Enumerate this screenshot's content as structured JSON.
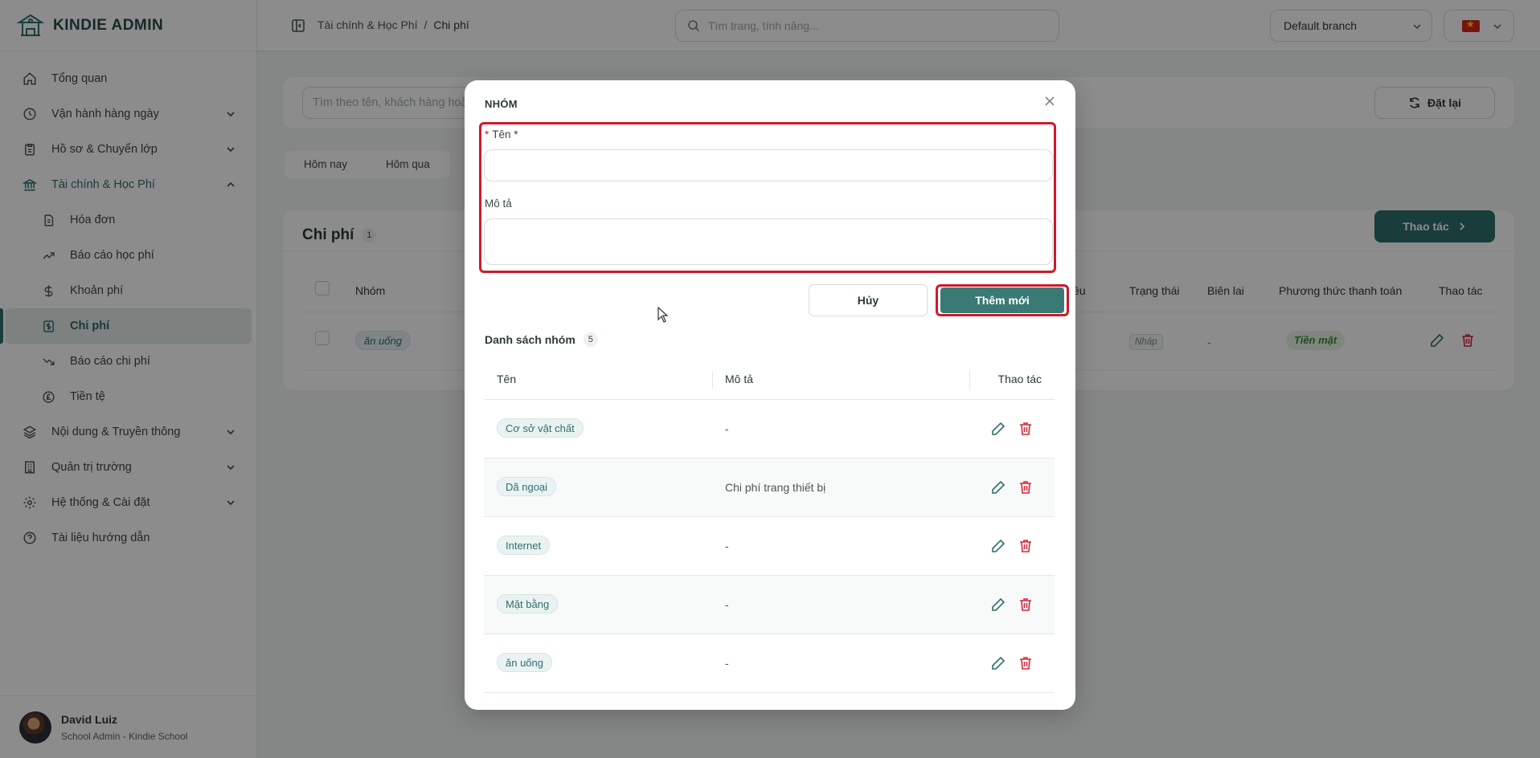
{
  "app": {
    "name": "KINDIE ADMIN"
  },
  "sidebar": {
    "items": [
      {
        "label": "Tổng quan",
        "icon": "home-icon"
      },
      {
        "label": "Vận hành hàng ngày",
        "icon": "clock-icon"
      },
      {
        "label": "Hồ sơ & Chuyển lớp",
        "icon": "clipboard-icon"
      },
      {
        "label": "Tài chính & Học Phí",
        "icon": "bank-icon"
      },
      {
        "label": "Nội dung & Truyền thông",
        "icon": "layers-icon"
      },
      {
        "label": "Quản trị trường",
        "icon": "building-icon"
      },
      {
        "label": "Hệ thống & Cài đặt",
        "icon": "gear-icon"
      },
      {
        "label": "Tài liệu hướng dẫn",
        "icon": "help-icon"
      }
    ],
    "finance_sub": [
      {
        "label": "Hóa đơn",
        "icon": "invoice-icon"
      },
      {
        "label": "Báo cáo học phí",
        "icon": "trend-up-icon"
      },
      {
        "label": "Khoản phí",
        "icon": "dollar-icon"
      },
      {
        "label": "Chi phí",
        "icon": "expense-icon"
      },
      {
        "label": "Báo cáo chi phí",
        "icon": "trend-down-icon"
      },
      {
        "label": "Tiền tệ",
        "icon": "currency-icon"
      }
    ]
  },
  "user": {
    "name": "David Luiz",
    "role": "School Admin - Kindie School"
  },
  "topbar": {
    "breadcrumb": [
      "Tài chính & Học Phí",
      "/",
      "Chi phí"
    ],
    "search_placeholder": "Tìm trang, tính năng...",
    "branch": "Default branch"
  },
  "main": {
    "filter_placeholder": "Tìm theo tên, khách hàng hoặc mã",
    "reset_label": "Đặt lại",
    "date_tabs": [
      "Hôm nay",
      "Hôm qua"
    ],
    "list_title": "Chi phí",
    "list_count": "1",
    "actions_label": "Thao tác",
    "headers": {
      "group": "Nhóm",
      "partial": "iều",
      "status": "Trạng thái",
      "receipt": "Biên lai",
      "payment": "Phương thức thanh toán",
      "actions": "Thao tác"
    },
    "row": {
      "group": "ăn uống",
      "status": "Nháp",
      "receipt": "-",
      "payment": "Tiền mặt"
    }
  },
  "modal": {
    "title": "NHÓM",
    "name_label": "Tên *",
    "name_value": "",
    "desc_label": "Mô tả",
    "desc_value": "",
    "cancel_label": "Hủy",
    "submit_label": "Thêm mới",
    "list_title": "Danh sách nhóm",
    "list_count": "5",
    "columns": {
      "name": "Tên",
      "desc": "Mô tả",
      "actions": "Thao tác"
    },
    "groups": [
      {
        "name": "Cơ sở vật chất",
        "desc": "-"
      },
      {
        "name": "Dã ngoại",
        "desc": "Chi phí trang thiết bị"
      },
      {
        "name": "Internet",
        "desc": "-"
      },
      {
        "name": "Mặt bằng",
        "desc": "-"
      },
      {
        "name": "ăn uống",
        "desc": "-"
      }
    ]
  },
  "colors": {
    "primary": "#2f6f6b",
    "danger": "#d0283a",
    "highlight": "#d0182a"
  }
}
